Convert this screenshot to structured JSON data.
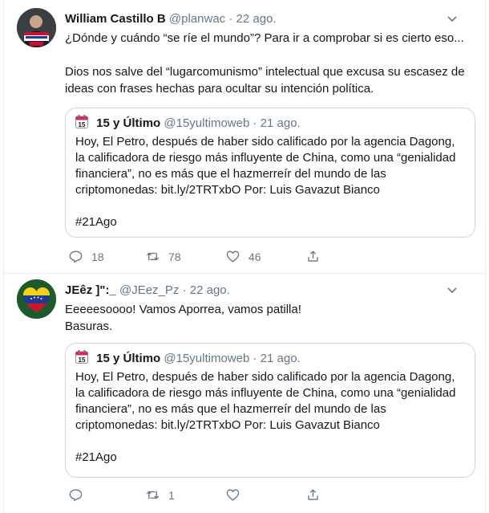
{
  "tweets": [
    {
      "author": "William Castillo B",
      "handle": "@planwac",
      "separator": "·",
      "date": "22 ago.",
      "avatar_icon": "trump-2020-avatar",
      "paragraphs": [
        "¿Dónde y cuándo “se ríe el mundo”? Para ir a comprobar si es cierto eso...",
        "Dios nos salve del “lugarcomunismo” intelectual que excusa su escasez de ideas con frases hechas para ocultar su intención política."
      ],
      "quote": {
        "icon": "calendar-15-icon",
        "author": "15 y Último",
        "handle": "@15yultimoweb",
        "separator": "·",
        "date": "21 ago.",
        "paragraphs": [
          "Hoy, El Petro, después de haber sido calificado por la agencia Dagong, la calificadora de riesgo más influyente de China, como una “genialidad financiera”, no es más que el hazmerreír del mundo de las criptomonedas: bit.ly/2TRTxbO Por: Luis Gavazut Bianco",
          "#21Ago"
        ]
      },
      "actions": {
        "replies": "18",
        "retweets": "78",
        "likes": "46"
      }
    },
    {
      "author": "JEêz ]\":_",
      "handle": "@JEez_Pz",
      "separator": "·",
      "date": "22 ago.",
      "avatar_icon": "venezuela-heart-avatar",
      "paragraphs": [
        "Eeeeesoooo! Vamos Aporrea, vamos patilla!\nBasuras."
      ],
      "quote": {
        "icon": "calendar-15-icon",
        "author": "15 y Último",
        "handle": "@15yultimoweb",
        "separator": "·",
        "date": "21 ago.",
        "paragraphs": [
          "Hoy, El Petro, después de haber sido calificado por la agencia Dagong, la calificadora de riesgo más influyente de China, como una “genialidad financiera”, no es más que el hazmerreír del mundo de las criptomonedas: bit.ly/2TRTxbO Por: Luis Gavazut Bianco",
          "#21Ago"
        ]
      },
      "actions": {
        "replies": "",
        "retweets": "1",
        "likes": ""
      }
    }
  ],
  "colors": {
    "text": "#14171a",
    "secondary": "#657786",
    "border": "#ccd6dd",
    "divider": "#e6ecf0",
    "calendar_red": "#e0245e"
  }
}
